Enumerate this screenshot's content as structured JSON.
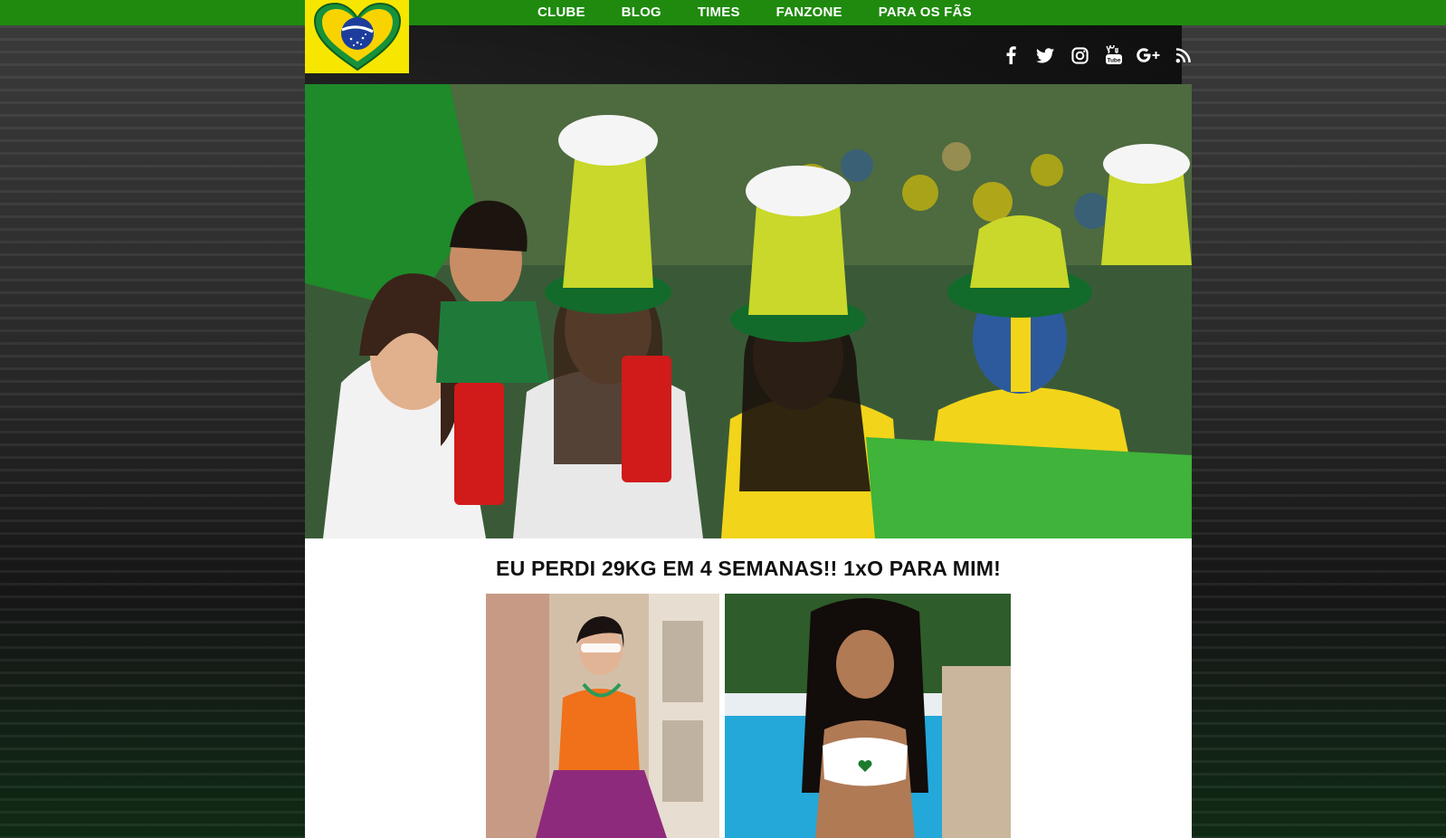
{
  "nav": {
    "items": [
      "CLUBE",
      "BLOG",
      "TIMES",
      "FANZONE",
      "PARA OS FÃS"
    ]
  },
  "logo": {
    "icon": "brazil-heart-logo-icon"
  },
  "social": {
    "icons": [
      "facebook-icon",
      "twitter-icon",
      "instagram-icon",
      "youtube-icon",
      "google-plus-icon",
      "rss-icon"
    ]
  },
  "main": {
    "headline": "EU PERDI 29KG EM 4 SEMANAS!! 1xO PARA MIM!"
  },
  "colors": {
    "topbar": "#1f8a0e",
    "logo_bg": "#f7e600",
    "brazil_green": "#17923a",
    "brazil_yellow": "#f9d300",
    "brazil_blue": "#1c3d9c"
  }
}
